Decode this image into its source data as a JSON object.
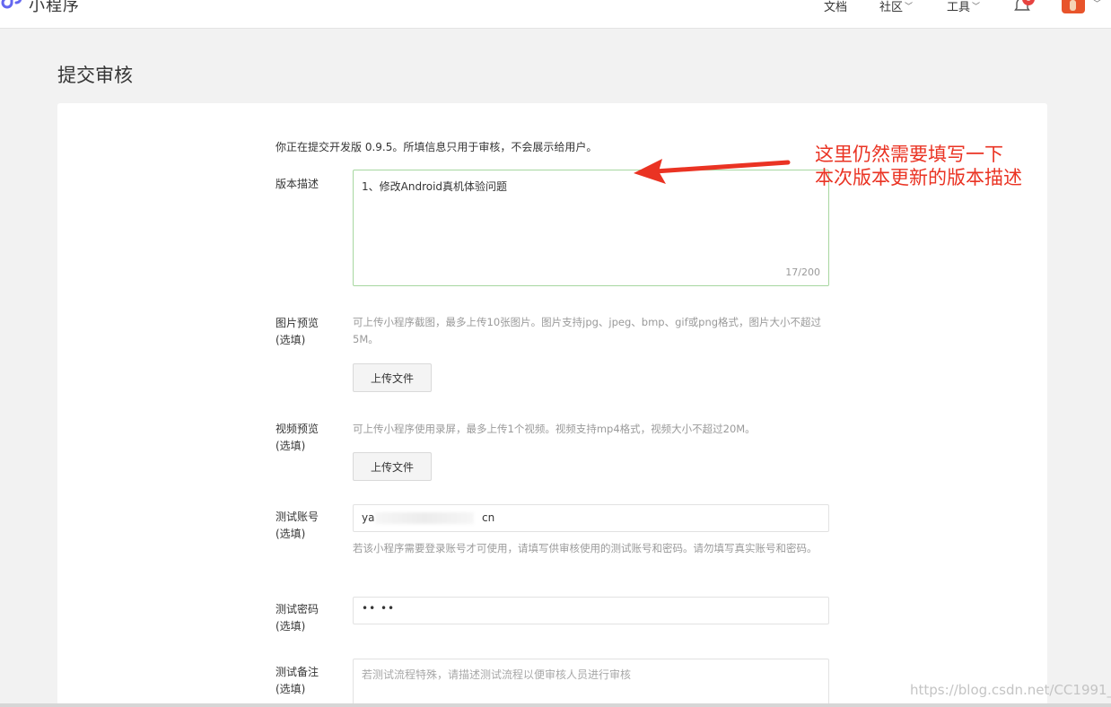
{
  "app": {
    "name": "小程序"
  },
  "nav": {
    "docs": "文档",
    "community": "社区",
    "tools": "工具",
    "notification_count": "8"
  },
  "page": {
    "title": "提交审核"
  },
  "form": {
    "intro": "你正在提交开发版 0.9.5。所填信息只用于审核，不会展示给用户。",
    "version_desc": {
      "label": "版本描述",
      "value": "1、修改Android真机体验问题",
      "counter": "17/200"
    },
    "image_preview": {
      "label_line1": "图片预览",
      "label_line2": "(选填)",
      "hint": "可上传小程序截图，最多上传10张图片。图片支持jpg、jpeg、bmp、gif或png格式，图片大小不超过5M。",
      "button": "上传文件"
    },
    "video_preview": {
      "label_line1": "视频预览",
      "label_line2": "(选填)",
      "hint": "可上传小程序使用录屏，最多上传1个视频。视频支持mp4格式，视频大小不超过20M。",
      "button": "上传文件"
    },
    "test_account": {
      "label_line1": "测试账号",
      "label_line2": "(选填)",
      "value_prefix": "ya",
      "value_suffix": "cn",
      "hint": "若该小程序需要登录账号才可使用，请填写供审核使用的测试账号和密码。请勿填写真实账号和密码。"
    },
    "test_password": {
      "label_line1": "测试密码",
      "label_line2": "(选填)",
      "value": "•• ••"
    },
    "test_notes": {
      "label_line1": "测试备注",
      "label_line2": "(选填)",
      "placeholder": "若测试流程特殊，请描述测试流程以便审核人员进行审核"
    }
  },
  "annotation": {
    "line1": "这里仍然需要填写一下",
    "line2": "本次版本更新的版本描述",
    "color": "#ea3323"
  },
  "watermark": "https://blog.csdn.net/CC1991_"
}
